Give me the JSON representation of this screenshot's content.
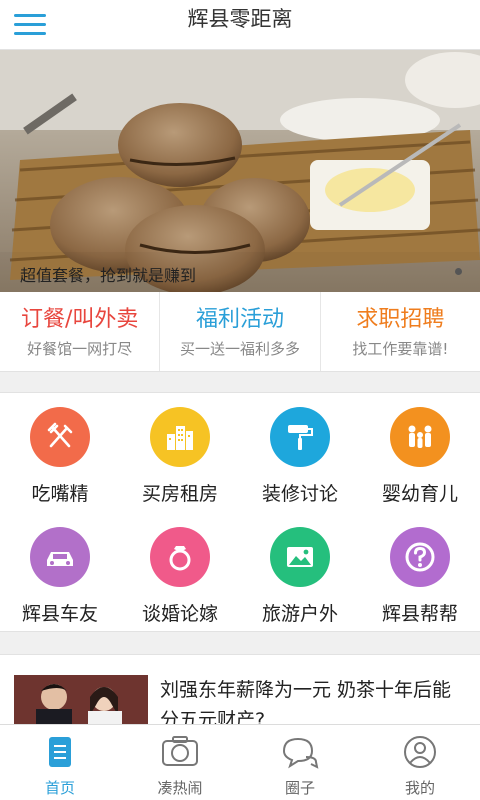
{
  "header": {
    "title": "辉县零距离"
  },
  "banner": {
    "caption": "超值套餐，抢到就是赚到"
  },
  "promos": [
    {
      "title": "订餐/叫外卖",
      "subtitle": "好餐馆一网打尽",
      "color": "#e8463e"
    },
    {
      "title": "福利活动",
      "subtitle": "买一送一福利多多",
      "color": "#2a9fd8"
    },
    {
      "title": "求职招聘",
      "subtitle": "找工作要靠谱!",
      "color": "#ef7d1e"
    }
  ],
  "categories": [
    {
      "label": "吃嘴精",
      "icon": "fork-knife-icon",
      "color": "#f26b4a"
    },
    {
      "label": "买房租房",
      "icon": "buildings-icon",
      "color": "#f6c324"
    },
    {
      "label": "装修讨论",
      "icon": "paint-roller-icon",
      "color": "#1ea7dc"
    },
    {
      "label": "婴幼育儿",
      "icon": "family-icon",
      "color": "#f3911f"
    },
    {
      "label": "辉县车友",
      "icon": "car-icon",
      "color": "#b270c9"
    },
    {
      "label": "谈婚论嫁",
      "icon": "ring-icon",
      "color": "#f05a8a"
    },
    {
      "label": "旅游户外",
      "icon": "picture-icon",
      "color": "#25bf7d"
    },
    {
      "label": "辉县帮帮",
      "icon": "question-icon",
      "color": "#b26ccf"
    }
  ],
  "news": {
    "title": "刘强东年薪降为一元 奶茶十年后能分五元财产?"
  },
  "tabs": [
    {
      "label": "首页",
      "icon": "home-doc-icon",
      "active": true
    },
    {
      "label": "凑热闹",
      "icon": "camera-icon",
      "active": false
    },
    {
      "label": "圈子",
      "icon": "chat-bubbles-icon",
      "active": false
    },
    {
      "label": "我的",
      "icon": "user-icon",
      "active": false
    }
  ]
}
